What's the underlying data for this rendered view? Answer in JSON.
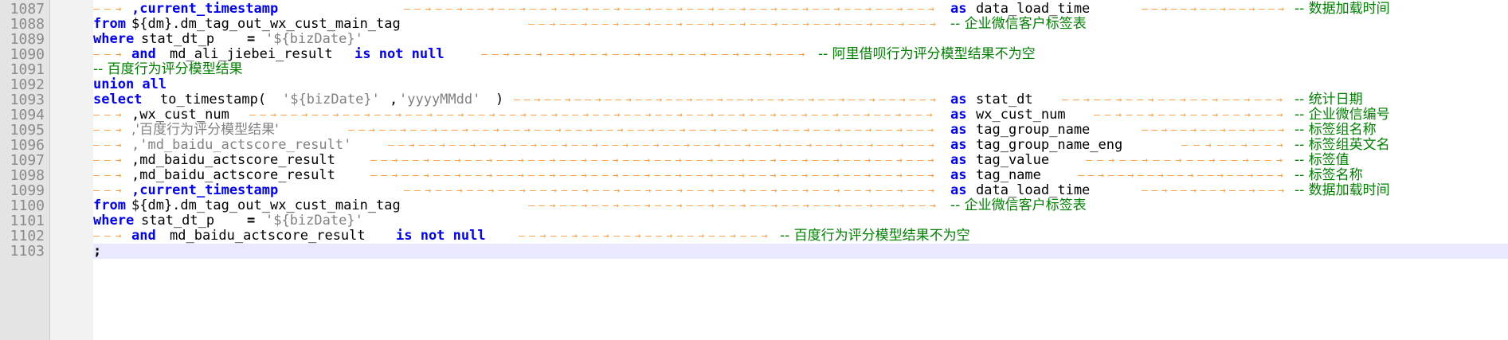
{
  "editor": {
    "lines": [
      {
        "num": "1087",
        "tokens": [
          [
            "arrow",
            "",
            0
          ],
          [
            "kw",
            ",current_timestamp",
            48
          ],
          [
            "arrow",
            "",
            390
          ],
          [
            "kw",
            "as",
            1076
          ],
          [
            "id",
            "data_load_time",
            1108
          ],
          [
            "arrow",
            "",
            1316
          ],
          [
            "cm",
            "-- 数据加载时间",
            1508
          ]
        ]
      },
      {
        "num": "1088",
        "tokens": [
          [
            "kw",
            "from",
            0
          ],
          [
            "id",
            "${dm}.dm_tag_out_wx_cust_main_tag",
            48
          ],
          [
            "arrow",
            "",
            546
          ],
          [
            "cm",
            "-- 企业微信客户标签表",
            1076
          ]
        ]
      },
      {
        "num": "1089",
        "tokens": [
          [
            "kw",
            "where",
            0
          ],
          [
            "id",
            "stat_dt_p",
            60
          ],
          [
            "op",
            "=",
            193
          ],
          [
            "str",
            "'${bizDate}'",
            216
          ]
        ]
      },
      {
        "num": "1090",
        "tokens": [
          [
            "arrow",
            "",
            0
          ],
          [
            "kw",
            "and",
            48
          ],
          [
            "id",
            "md_ali_jiebei_result",
            96
          ],
          [
            "kw",
            "is not null",
            328
          ],
          [
            "arrow",
            "",
            487
          ],
          [
            "cm",
            "-- 阿里借呗行为评分模型结果不为空",
            910
          ]
        ]
      },
      {
        "num": "1091",
        "tokens": [
          [
            "cm",
            "-- 百度行为评分模型结果",
            0
          ]
        ]
      },
      {
        "num": "1092",
        "tokens": [
          [
            "kw",
            "union all",
            0
          ]
        ]
      },
      {
        "num": "1093",
        "tokens": [
          [
            "kw",
            "select",
            0
          ],
          [
            "id",
            "to_timestamp(",
            84
          ],
          [
            "str",
            "'${bizDate}'",
            237
          ],
          [
            "id",
            ",",
            372
          ],
          [
            "str",
            "'yyyyMMdd'",
            384
          ],
          [
            "id",
            ")",
            505
          ],
          [
            "arrow",
            "",
            528
          ],
          [
            "kw",
            "as",
            1076
          ],
          [
            "id",
            "stat_dt",
            1108
          ],
          [
            "arrow",
            "",
            1216
          ],
          [
            "cm",
            "-- 统计日期",
            1508
          ]
        ]
      },
      {
        "num": "1094",
        "tokens": [
          [
            "arrow",
            "",
            0
          ],
          [
            "id",
            ",wx_cust_num",
            48
          ],
          [
            "arrow",
            "",
            196
          ],
          [
            "kw",
            "as",
            1076
          ],
          [
            "id",
            "wx_cust_num",
            1108
          ],
          [
            "arrow",
            "",
            1256
          ],
          [
            "cm",
            "-- 企业微信编号",
            1508
          ]
        ]
      },
      {
        "num": "1095",
        "tokens": [
          [
            "arrow",
            "",
            0
          ],
          [
            "str",
            ",'百度行为评分模型结果'",
            48
          ],
          [
            "arrow",
            "",
            320
          ],
          [
            "kw",
            "as",
            1076
          ],
          [
            "id",
            "tag_group_name",
            1108
          ],
          [
            "arrow",
            "",
            1316
          ],
          [
            "cm",
            "-- 标签组名称",
            1508
          ]
        ]
      },
      {
        "num": "1096",
        "tokens": [
          [
            "arrow",
            "",
            0
          ],
          [
            "str",
            ",'md_baidu_actscore_result'",
            48
          ],
          [
            "arrow",
            "",
            370
          ],
          [
            "kw",
            "as",
            1076
          ],
          [
            "id",
            "tag_group_name_eng",
            1108
          ],
          [
            "arrow",
            "",
            1366
          ],
          [
            "cm",
            "-- 标签组英文名",
            1508
          ]
        ]
      },
      {
        "num": "1097",
        "tokens": [
          [
            "arrow",
            "",
            0
          ],
          [
            "id",
            ",md_baidu_actscore_result",
            48
          ],
          [
            "arrow",
            "",
            348
          ],
          [
            "kw",
            "as",
            1076
          ],
          [
            "id",
            "tag_value",
            1108
          ],
          [
            "arrow",
            "",
            1246
          ],
          [
            "cm",
            "-- 标签值",
            1508
          ]
        ]
      },
      {
        "num": "1098",
        "tokens": [
          [
            "arrow",
            "",
            0
          ],
          [
            "id",
            ",md_baidu_actscore_result",
            48
          ],
          [
            "arrow",
            "",
            348
          ],
          [
            "kw",
            "as",
            1076
          ],
          [
            "id",
            "tag_name",
            1108
          ],
          [
            "arrow",
            "",
            1236
          ],
          [
            "cm",
            "-- 标签名称",
            1508
          ]
        ]
      },
      {
        "num": "1099",
        "tokens": [
          [
            "arrow",
            "",
            0
          ],
          [
            "kw",
            ",current_timestamp",
            48
          ],
          [
            "arrow",
            "",
            390
          ],
          [
            "kw",
            "as",
            1076
          ],
          [
            "id",
            "data_load_time",
            1108
          ],
          [
            "arrow",
            "",
            1316
          ],
          [
            "cm",
            "-- 数据加载时间",
            1508
          ]
        ]
      },
      {
        "num": "1100",
        "tokens": [
          [
            "kw",
            "from",
            0
          ],
          [
            "id",
            "${dm}.dm_tag_out_wx_cust_main_tag",
            48
          ],
          [
            "arrow",
            "",
            546
          ],
          [
            "cm",
            "-- 企业微信客户标签表",
            1076
          ]
        ]
      },
      {
        "num": "1101",
        "tokens": [
          [
            "kw",
            "where",
            0
          ],
          [
            "id",
            "stat_dt_p",
            60
          ],
          [
            "op",
            "=",
            193
          ],
          [
            "str",
            "'${bizDate}'",
            216
          ]
        ]
      },
      {
        "num": "1102",
        "tokens": [
          [
            "arrow",
            "",
            0
          ],
          [
            "kw",
            "and",
            48
          ],
          [
            "id",
            "md_baidu_actscore_result",
            96
          ],
          [
            "kw",
            "is not null",
            380
          ],
          [
            "arrow",
            "",
            534
          ],
          [
            "cm",
            "-- 百度行为评分模型结果不为空",
            862
          ]
        ]
      },
      {
        "num": "1103",
        "tokens": [
          [
            "op",
            ";",
            0
          ]
        ]
      }
    ],
    "current_line": "1103"
  },
  "colors": {
    "keyword": "#0000ff",
    "string": "#808080",
    "comment": "#008000",
    "whitespace_arrow": "#ff9a3c",
    "line_number": "#8a8a8a",
    "current_line_bg": "#e8e8ff"
  }
}
